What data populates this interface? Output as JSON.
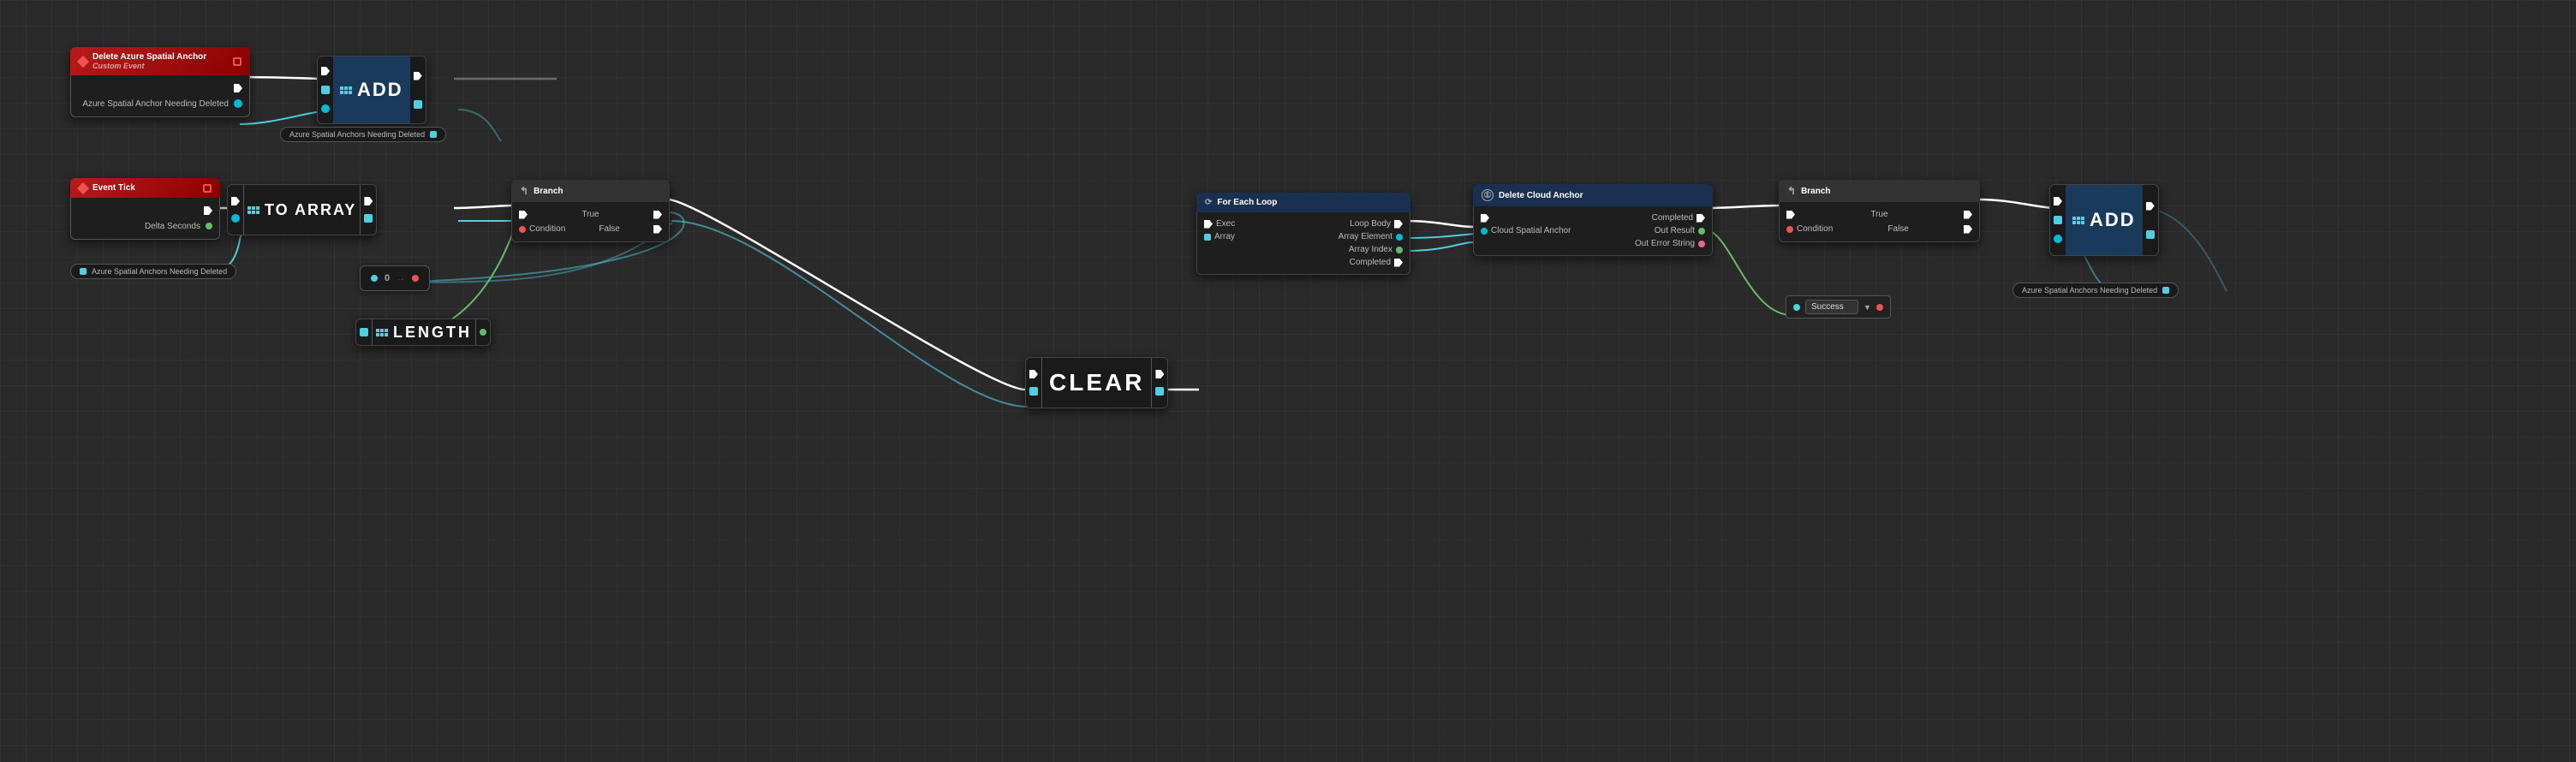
{
  "nodes": {
    "delete_azure_anchor": {
      "title": "Delete Azure Spatial Anchor",
      "subtitle": "Custom Event",
      "type": "custom_event"
    },
    "add_top": {
      "label": "ADD",
      "type": "add"
    },
    "to_array": {
      "label": "TO ARRAY",
      "type": "big"
    },
    "event_tick": {
      "title": "Event Tick",
      "type": "event"
    },
    "branch_left": {
      "title": "Branch",
      "type": "branch"
    },
    "clear": {
      "label": "CLEAR",
      "type": "big"
    },
    "for_each_loop": {
      "title": "For Each Loop",
      "type": "loop"
    },
    "delete_cloud_anchor": {
      "title": "Delete Cloud Anchor",
      "type": "function"
    },
    "branch_right": {
      "title": "Branch",
      "type": "branch"
    },
    "add_bottom": {
      "label": "ADD",
      "type": "add"
    },
    "length": {
      "label": "LENGTH",
      "type": "big"
    }
  },
  "labels": {
    "azure_spatial_anchor_needing_deleted_top": "Azure Spatial Anchor Needing Deleted",
    "azure_spatial_anchors_needing_deleted_top": "Azure Spatial Anchors Needing Deleted",
    "azure_spatial_anchors_needing_deleted_bottom": "Azure Spatial Anchors Needing Deleted",
    "azure_spatial_anchors_needing_deleted_right": "Azure Spatial Anchors Needing Deleted",
    "delta_seconds": "Delta Seconds",
    "condition": "Condition",
    "true_label": "True",
    "false_label": "False",
    "exec": "Exec",
    "array": "Array",
    "loop_body": "Loop Body",
    "array_element": "Array Element",
    "array_index": "Array Index",
    "completed": "Completed",
    "cloud_spatial_anchor": "Cloud Spatial Anchor",
    "out_result": "Out Result",
    "out_error_string": "Out Error String",
    "success": "Success",
    "clear_label": "CLEAR"
  }
}
